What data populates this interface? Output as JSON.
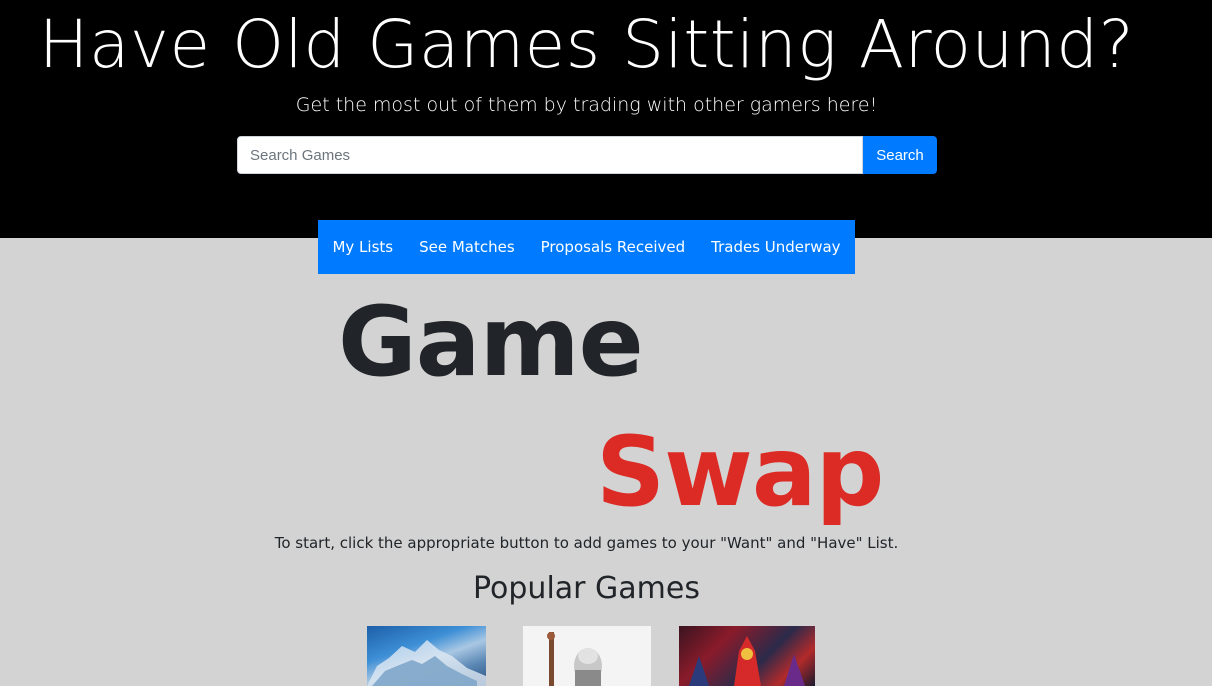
{
  "hero": {
    "title": "Have Old Games Sitting Around?",
    "subtitle": "Get the most out of them by trading with other gamers here!"
  },
  "search": {
    "placeholder": "Search Games",
    "value": "",
    "button_label": "Search"
  },
  "nav": {
    "items": [
      {
        "label": "My Lists"
      },
      {
        "label": "See Matches"
      },
      {
        "label": "Proposals Received"
      },
      {
        "label": "Trades Underway"
      }
    ]
  },
  "logo": {
    "word1": "Game",
    "word2": "Swap"
  },
  "intro_text": "To start, click the appropriate button to add games to your \"Want\" and \"Have\" List.",
  "popular": {
    "title": "Popular Games"
  },
  "colors": {
    "hero_bg": "#000000",
    "page_bg": "#d3d3d3",
    "accent": "#007bff",
    "swap_red": "#dc2b25"
  }
}
